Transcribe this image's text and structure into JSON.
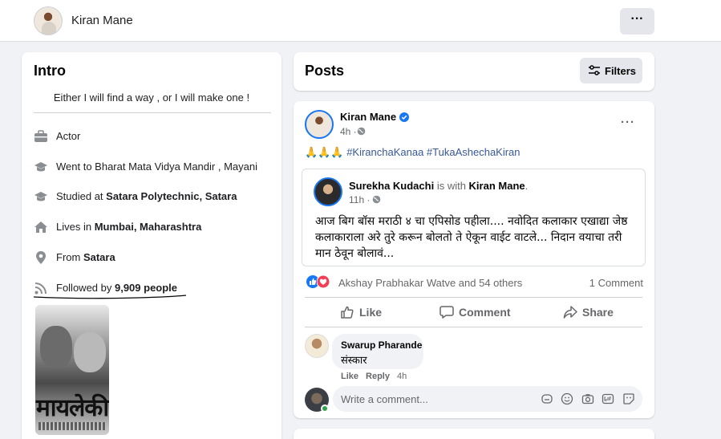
{
  "header": {
    "name": "Kiran Mane",
    "more_label": "···"
  },
  "intro": {
    "title": "Intro",
    "bio": "Either I will find a way , or I will make one !",
    "items": [
      {
        "icon": "briefcase-icon",
        "prefix": "Actor",
        "bold": "",
        "suffix": ""
      },
      {
        "icon": "graduation-cap-icon",
        "prefix": "Went to Bharat Mata Vidya Mandir , Mayani",
        "bold": "",
        "suffix": ""
      },
      {
        "icon": "graduation-cap-icon",
        "prefix": "Studied at ",
        "bold": "Satara Polytechnic, Satara",
        "suffix": ""
      },
      {
        "icon": "home-icon",
        "prefix": "Lives in ",
        "bold": "Mumbai, Maharashtra",
        "suffix": ""
      },
      {
        "icon": "location-pin-icon",
        "prefix": "From ",
        "bold": "Satara",
        "suffix": ""
      },
      {
        "icon": "rss-icon",
        "prefix": "Followed by ",
        "bold": "9,909 people",
        "suffix": ""
      }
    ],
    "poster_title": "मायलेकी"
  },
  "posts": {
    "title": "Posts",
    "filters_label": "Filters"
  },
  "post": {
    "author": "Kiran Mane",
    "time": "4h ·",
    "more_label": "···",
    "emoji": "🙏🙏🙏",
    "hashtags": "#KiranchaKanaa #TukaAshechaKiran",
    "shared": {
      "author": "Surekha Kudachi",
      "with_text": " is with ",
      "tagged": "Kiran Mane",
      "end": ".",
      "time": "11h ·",
      "text": "आज बिग बॉस मराठी ४ चा एपिसोड पहीला.... नवोदित कलाकार एखाद्या जेष्ठ कलाकाराला अरे तुरे करून बोलतो ते ऐकून वाईट वाटले... निदान वयाचा तरी मान ठेवून बोलावं..."
    },
    "reactions_text": "Akshay Prabhakar Watve and 54 others",
    "comments_count": "1 Comment",
    "actions": {
      "like": "Like",
      "comment": "Comment",
      "share": "Share"
    },
    "comment": {
      "author": "Swarup Pharande",
      "text": "संस्कार",
      "like": "Like",
      "reply": "Reply",
      "time": "4h"
    },
    "write_placeholder": "Write a comment..."
  },
  "colors": {
    "accent": "#1877f2",
    "link": "#385898",
    "muted": "#65676b",
    "love": "#f33e58",
    "online": "#31a24c"
  }
}
